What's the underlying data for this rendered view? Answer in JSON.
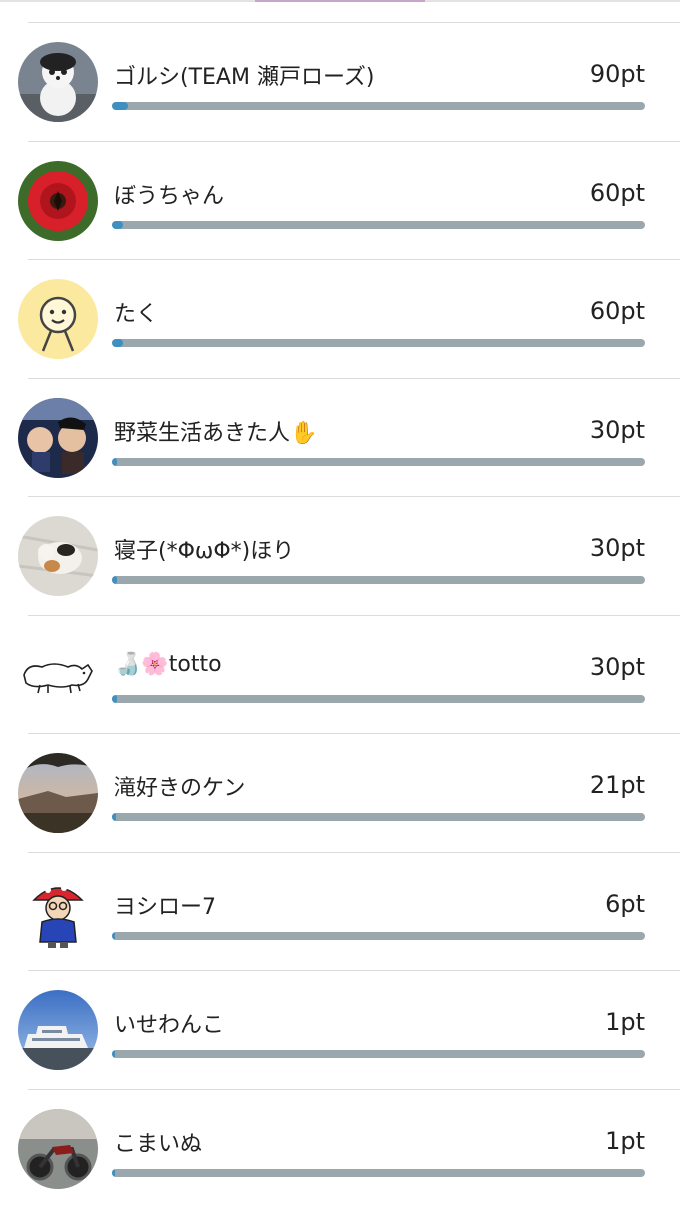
{
  "ranking": [
    {
      "name": "ゴルシ(TEAM 瀬戸ローズ)",
      "points": "90pt",
      "progress_fraction": 0.03,
      "avatar_icon": "plush-toy-avatar-icon"
    },
    {
      "name": "ぼうちゃん",
      "points": "60pt",
      "progress_fraction": 0.02,
      "avatar_icon": "red-tulip-avatar-icon"
    },
    {
      "name": "たく",
      "points": "60pt",
      "progress_fraction": 0.02,
      "avatar_icon": "default-face-avatar-icon"
    },
    {
      "name": "野菜生活あきた人✋",
      "points": "30pt",
      "progress_fraction": 0.01,
      "avatar_icon": "two-people-avatar-icon"
    },
    {
      "name": "寝子(*ΦωΦ*)ほり",
      "points": "30pt",
      "progress_fraction": 0.01,
      "avatar_icon": "sleeping-cat-avatar-icon"
    },
    {
      "name": "🍶🌸totto",
      "points": "30pt",
      "progress_fraction": 0.01,
      "avatar_icon": "sheep-sketch-avatar-icon"
    },
    {
      "name": "滝好きのケン",
      "points": "21pt",
      "progress_fraction": 0.007,
      "avatar_icon": "sunset-landscape-avatar-icon"
    },
    {
      "name": "ヨシロー7",
      "points": "6pt",
      "progress_fraction": 0.002,
      "avatar_icon": "cartoon-mushroom-avatar-icon"
    },
    {
      "name": "いせわんこ",
      "points": "1pt",
      "progress_fraction": 0.0005,
      "avatar_icon": "ferry-ship-avatar-icon"
    },
    {
      "name": "こまいぬ",
      "points": "1pt",
      "progress_fraction": 0.0005,
      "avatar_icon": "motorcycle-avatar-icon"
    }
  ],
  "colors": {
    "bar_track": "#9aa7ad",
    "bar_fill": "#3f8fc0",
    "divider": "#dcdcdc"
  }
}
